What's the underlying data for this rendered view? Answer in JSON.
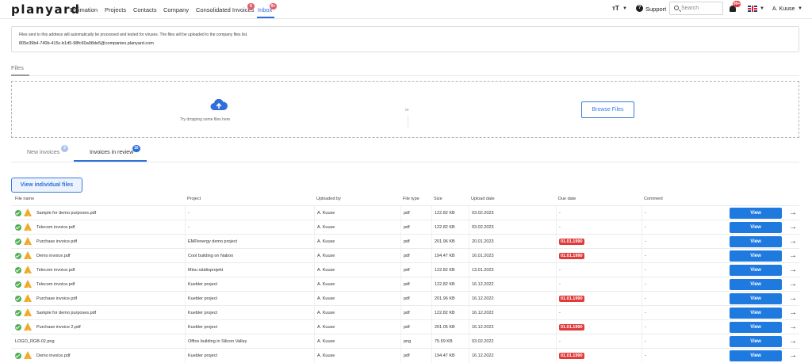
{
  "app": {
    "logo": "planyard"
  },
  "nav": {
    "items": [
      {
        "label": "Estimation"
      },
      {
        "label": "Projects"
      },
      {
        "label": "Contacts"
      },
      {
        "label": "Company"
      },
      {
        "label": "Consolidated Invoices",
        "badge": "6"
      },
      {
        "label": "Inbox",
        "badge": "9+",
        "active": true
      }
    ],
    "text_size_icon": "ᴛT",
    "support_label": "Support",
    "search_placeholder": "Search",
    "notifications_badge": "99+",
    "user_name": "A. Kuuse"
  },
  "info": {
    "text": "Files sent to this address will automatically be processed and tested for viruses. The files will be uploaded to the company files list.",
    "email": "805e39b4-740b-415c-b1d5-98fc60a98de5@companies.planyard.com"
  },
  "files": {
    "title": "Files",
    "drop_text": "Try dropping some files here",
    "or_text": "or",
    "browse_label": "Browse Files"
  },
  "tabs": [
    {
      "label": "New invoices",
      "badge": "2",
      "active": false
    },
    {
      "label": "Invoices in review",
      "badge": "16",
      "active": true
    }
  ],
  "view_individual_label": "View individual files",
  "table": {
    "columns": [
      "File name",
      "Project",
      "Uploaded by",
      "File type",
      "Size",
      "Upload date",
      "Due date",
      "Comment"
    ],
    "view_label": "View",
    "rows": [
      {
        "name": "Sample for demo purposes.pdf",
        "project": "-",
        "by": "A. Kuuse",
        "type": "pdf",
        "size": "122.82 KB",
        "date": "03.02.2023",
        "due": "-",
        "overdue": false,
        "comment": "-",
        "status": [
          "check",
          "warn"
        ]
      },
      {
        "name": "Telecom invoice.pdf",
        "project": "-",
        "by": "A. Kuuse",
        "type": "pdf",
        "size": "122.82 KB",
        "date": "03.02.2023",
        "due": "-",
        "overdue": false,
        "comment": "-",
        "status": [
          "check",
          "warn"
        ]
      },
      {
        "name": "Purchase invoice.pdf",
        "project": "EMPenergy demo project",
        "by": "A. Kuuse",
        "type": "pdf",
        "size": "201.96 KB",
        "date": "20.01.2023",
        "due": "01.01.1990",
        "overdue": true,
        "comment": "-",
        "status": [
          "check",
          "warn"
        ]
      },
      {
        "name": "Demo invoice.pdf",
        "project": "Cool building on Naboo",
        "by": "A. Kuuse",
        "type": "pdf",
        "size": "194.47 KB",
        "date": "16.01.2023",
        "due": "01.01.1990",
        "overdue": true,
        "comment": "-",
        "status": [
          "check",
          "warn"
        ]
      },
      {
        "name": "Telecom invoice.pdf",
        "project": "Minu näidisprojekt",
        "by": "A. Kuuse",
        "type": "pdf",
        "size": "122.82 KB",
        "date": "13.01.2023",
        "due": "-",
        "overdue": false,
        "comment": "-",
        "status": [
          "check",
          "warn"
        ]
      },
      {
        "name": "Telecom invoice.pdf",
        "project": "Kuebler project",
        "by": "A. Kuuse",
        "type": "pdf",
        "size": "122.82 KB",
        "date": "16.12.2022",
        "due": "-",
        "overdue": false,
        "comment": "-",
        "status": [
          "check",
          "warn"
        ]
      },
      {
        "name": "Purchase invoice.pdf",
        "project": "Kuebler project",
        "by": "A. Kuuse",
        "type": "pdf",
        "size": "201.96 KB",
        "date": "16.12.2022",
        "due": "01.01.1990",
        "overdue": true,
        "comment": "-",
        "status": [
          "check",
          "warn"
        ]
      },
      {
        "name": "Sample for demo purposes.pdf",
        "project": "Kuebler project",
        "by": "A. Kuuse",
        "type": "pdf",
        "size": "122.82 KB",
        "date": "16.12.2022",
        "due": "-",
        "overdue": false,
        "comment": "-",
        "status": [
          "check",
          "warn"
        ]
      },
      {
        "name": "Purchase invoice 2.pdf",
        "project": "Kuebler project",
        "by": "A. Kuuse",
        "type": "pdf",
        "size": "201.05 KB",
        "date": "16.12.2022",
        "due": "01.01.1990",
        "overdue": true,
        "comment": "-",
        "status": [
          "check",
          "warn"
        ]
      },
      {
        "name": "LOGO_RGB-02.png",
        "project": "Office building in Silicon Valley",
        "by": "A. Kuuse",
        "type": "png",
        "size": "75.59 KB",
        "date": "03.02.2022",
        "due": "-",
        "overdue": false,
        "comment": "-",
        "status": []
      },
      {
        "name": "Demo invoice.pdf",
        "project": "Kuebler project",
        "by": "A. Kuuse",
        "type": "pdf",
        "size": "194.47 KB",
        "date": "16.12.2022",
        "due": "01.01.1990",
        "overdue": true,
        "comment": "-",
        "status": [
          "check",
          "warn"
        ]
      }
    ]
  },
  "colors": {
    "accent": "#1f7ae0",
    "link": "#2f6fdc",
    "danger": "#e03b3b",
    "success": "#4caf50",
    "warning": "#f2a824"
  }
}
